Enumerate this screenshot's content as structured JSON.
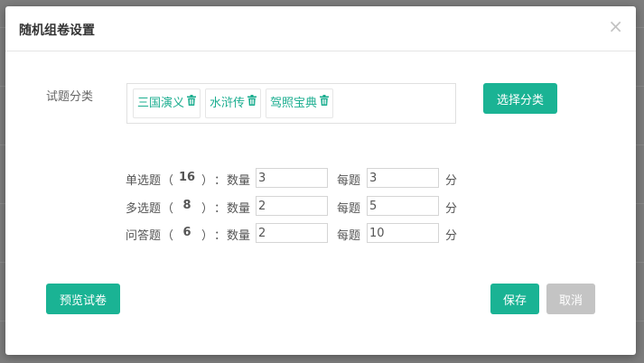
{
  "dialog": {
    "title": "随机组卷设置",
    "close_glyph": "×"
  },
  "category": {
    "label": "试题分类",
    "tags": [
      {
        "name": "三国演义"
      },
      {
        "name": "水浒传"
      },
      {
        "name": "驾照宝典"
      }
    ],
    "select_button": "选择分类"
  },
  "questions": [
    {
      "type_label": "单选题",
      "count": "16",
      "qty_label": "数量",
      "qty_value": "3",
      "score_label": "每题",
      "score_value": "3",
      "unit": "分"
    },
    {
      "type_label": "多选题",
      "count": "8",
      "qty_label": "数量",
      "qty_value": "2",
      "score_label": "每题",
      "score_value": "5",
      "unit": "分"
    },
    {
      "type_label": "问答题",
      "count": "6",
      "qty_label": "数量",
      "qty_value": "2",
      "score_label": "每题",
      "score_value": "10",
      "unit": "分"
    }
  ],
  "punct": {
    "open": "（",
    "close": "）",
    "colon": "："
  },
  "footer": {
    "preview_button": "预览试卷",
    "save_button": "保存",
    "cancel_button": "取消"
  },
  "colors": {
    "accent": "#1ab394",
    "disabled": "#c4c4c4"
  }
}
